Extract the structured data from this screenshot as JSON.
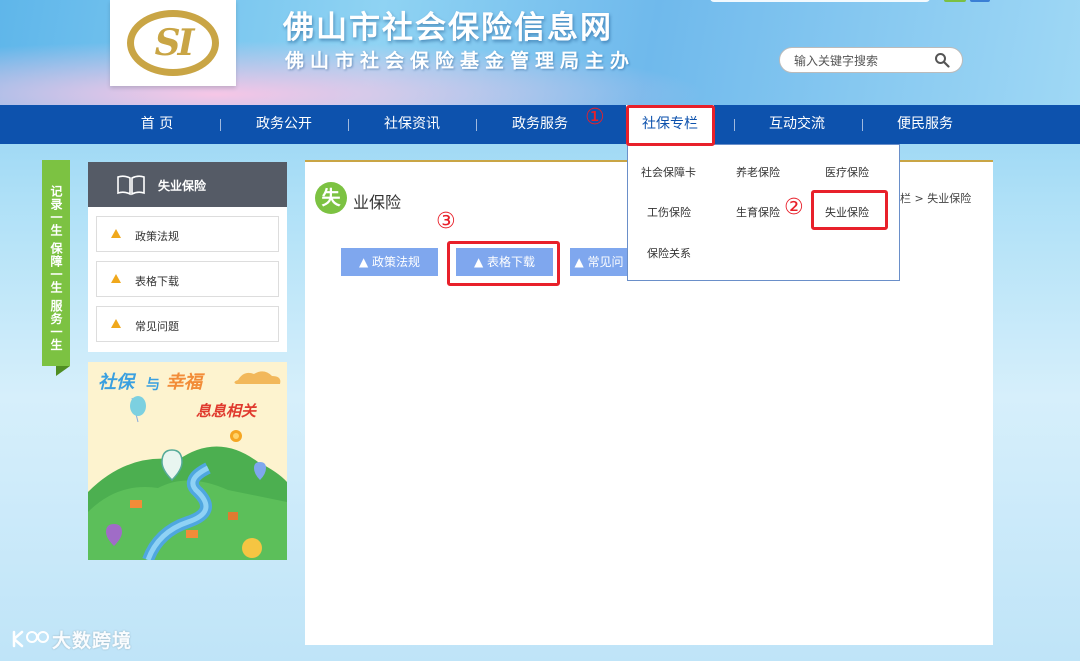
{
  "header": {
    "logo_text": "SI",
    "site_title": "佛山市社会保险信息网",
    "site_subtitle": "佛山市社会保险基金管理局主办",
    "search_placeholder": "输入关键字搜索"
  },
  "nav": {
    "items": [
      {
        "label": "首 页"
      },
      {
        "label": "政务公开"
      },
      {
        "label": "社保资讯"
      },
      {
        "label": "政务服务"
      },
      {
        "label": "社保专栏"
      },
      {
        "label": "互动交流"
      },
      {
        "label": "便民服务"
      }
    ],
    "active_index": 4
  },
  "dropdown": {
    "items": [
      {
        "label": "社会保障卡"
      },
      {
        "label": "养老保险"
      },
      {
        "label": "医疗保险"
      },
      {
        "label": "工伤保险"
      },
      {
        "label": "生育保险"
      },
      {
        "label": "失业保险"
      },
      {
        "label": "保险关系"
      }
    ]
  },
  "vertical_tab": {
    "text": "记录一生 保障一生 服务一生"
  },
  "sidebar": {
    "title": "失业保险",
    "items": [
      {
        "label": "政策法规"
      },
      {
        "label": "表格下载"
      },
      {
        "label": "常见问题"
      }
    ]
  },
  "banner": {
    "title_part1": "社保",
    "title_mid": "与",
    "title_part2": "幸福",
    "subtitle": "息息相关"
  },
  "content": {
    "section_icon_char": "失",
    "section_title": "业保险",
    "breadcrumb": "栏 > 失业保险",
    "tabs": [
      {
        "label": "▲ 政策法规"
      },
      {
        "label": "▲ 表格下载"
      },
      {
        "label": "▲ 常见问"
      }
    ]
  },
  "annotations": {
    "step1": "①",
    "step2": "②",
    "step3": "③",
    "color": "#e8202a"
  },
  "watermark": {
    "text": "大数跨境"
  },
  "colors": {
    "nav_bg": "#0d52ad",
    "accent_green": "#7cc242",
    "tab_blue": "#7fa7ee",
    "gold": "#c9a545"
  }
}
